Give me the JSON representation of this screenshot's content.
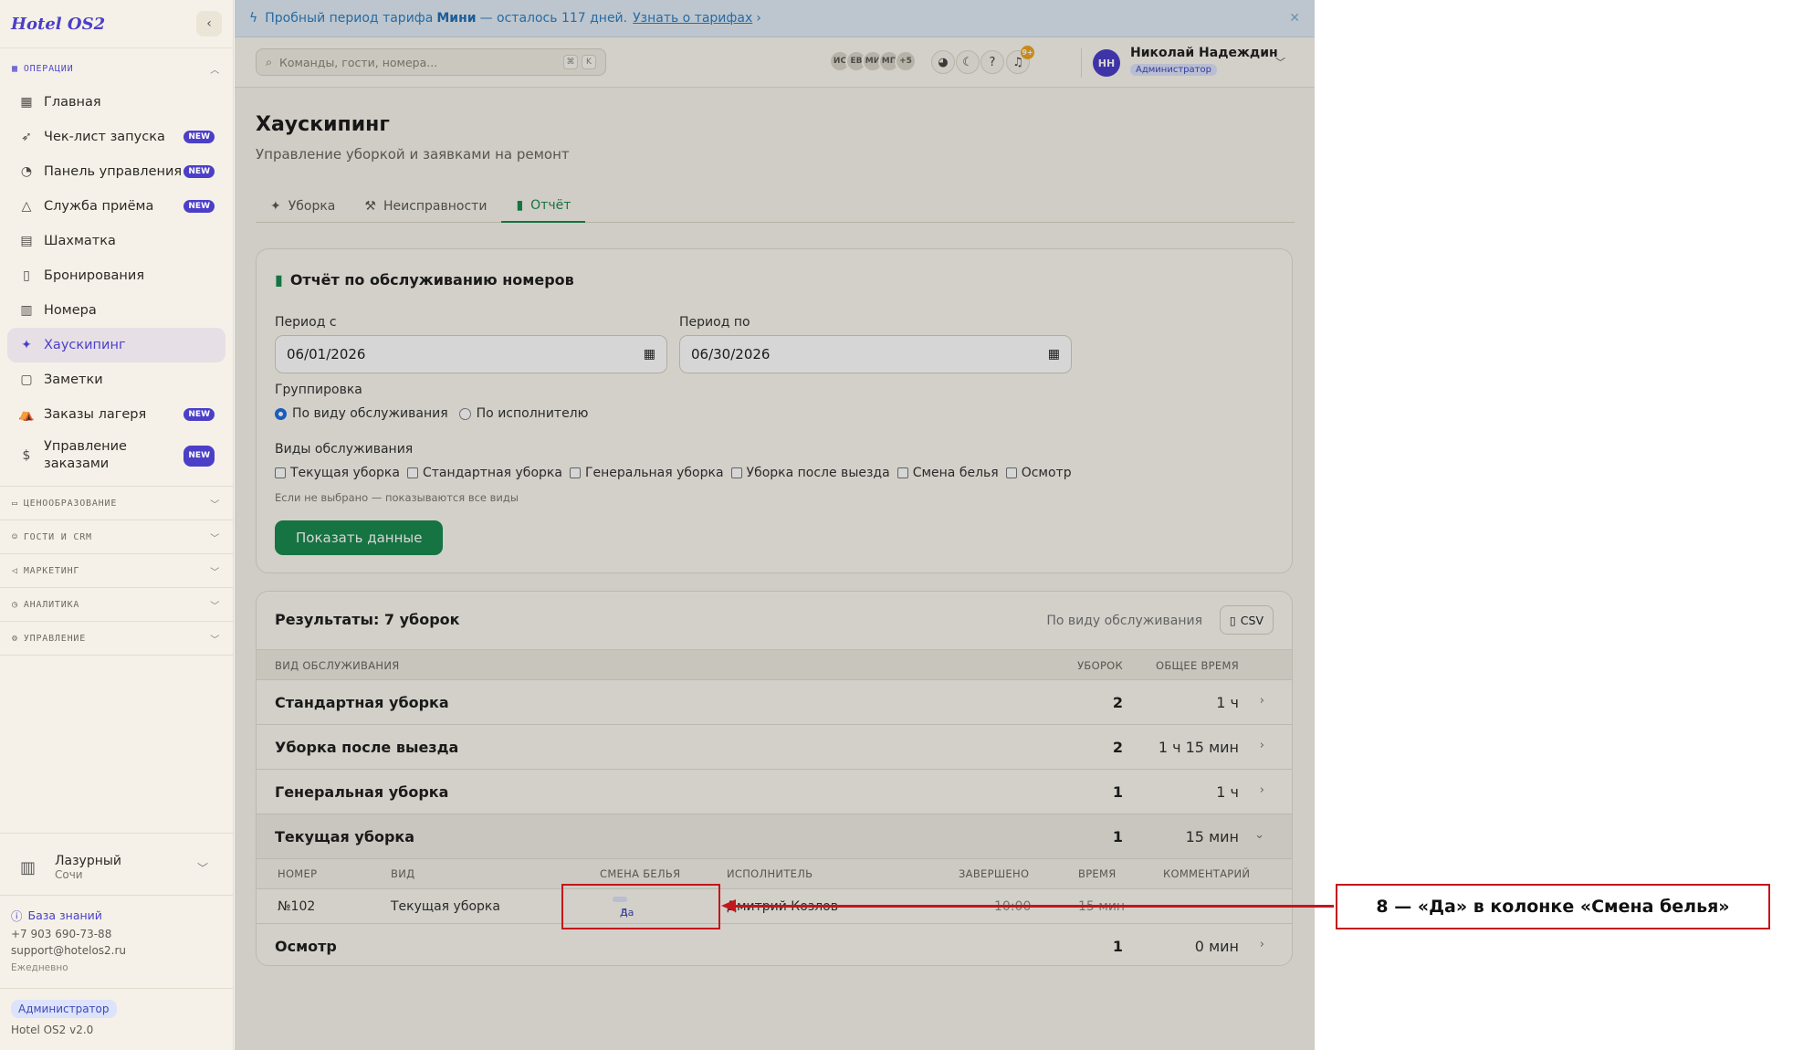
{
  "sidebar": {
    "brand": "Hotel OS2",
    "operations_label": "ОПЕРАЦИИ",
    "items": [
      {
        "label": "Главная",
        "badge": ""
      },
      {
        "label": "Чек-лист запуска",
        "badge": "NEW"
      },
      {
        "label": "Панель управления",
        "badge": "NEW"
      },
      {
        "label": "Служба приёма",
        "badge": "NEW"
      },
      {
        "label": "Шахматка",
        "badge": ""
      },
      {
        "label": "Бронирования",
        "badge": ""
      },
      {
        "label": "Номера",
        "badge": ""
      },
      {
        "label": "Хаускипинг",
        "badge": "",
        "active": true
      },
      {
        "label": "Заметки",
        "badge": ""
      },
      {
        "label": "Заказы лагеря",
        "badge": "NEW"
      },
      {
        "label": "Управление заказами",
        "badge": "NEW"
      }
    ],
    "sections": [
      "ЦЕНООБРАЗОВАНИЕ",
      "ГОСТИ И CRM",
      "МАРКЕТИНГ",
      "АНАЛИТИКА",
      "УПРАВЛЕНИЕ"
    ],
    "hotel": {
      "name": "Лазурный",
      "city": "Сочи"
    },
    "knowledge_base": "База знаний",
    "phone": "+7 903 690-73-88",
    "email": "support@hotelos2.ru",
    "schedule": "Ежедневно",
    "role": "Администратор",
    "version": "Hotel OS2 v2.0"
  },
  "banner": {
    "prefix": "Пробный период тарифа",
    "plan": "Мини",
    "suffix": "— осталось 117 дней.",
    "link": "Узнать о тарифах"
  },
  "topbar": {
    "search_placeholder": "Команды, гости, номера...",
    "kbd": [
      "⌘",
      "K"
    ],
    "avatars": [
      "ИС",
      "ЕВ",
      "МИ",
      "МП",
      "+5"
    ],
    "notif_count": "9+",
    "user_initials": "НН",
    "user_name": "Николай Надеждин",
    "user_role": "Администратор"
  },
  "page": {
    "title": "Хаускипинг",
    "subtitle": "Управление уборкой и заявками на ремонт",
    "tabs": [
      "Уборка",
      "Неисправности",
      "Отчёт"
    ],
    "active_tab": "Отчёт"
  },
  "filters": {
    "title": "Отчёт по обслуживанию номеров",
    "from_label": "Период с",
    "from_value": "06/01/2026",
    "to_label": "Период по",
    "to_value": "06/30/2026",
    "grouping_label": "Группировка",
    "grouping_options": [
      "По виду обслуживания",
      "По исполнителю"
    ],
    "grouping_selected": "По виду обслуживания",
    "types_label": "Виды обслуживания",
    "types": [
      "Текущая уборка",
      "Стандартная уборка",
      "Генеральная уборка",
      "Уборка после выезда",
      "Смена белья",
      "Осмотр"
    ],
    "hint": "Если не выбрано — показываются все виды",
    "show_button": "Показать данные"
  },
  "results": {
    "title": "Результаты: 7 уборок",
    "group_by": "По виду обслуживания",
    "csv": "CSV",
    "columns": [
      "ВИД ОБСЛУЖИВАНИЯ",
      "УБОРОК",
      "ОБЩЕЕ ВРЕМЯ"
    ],
    "groups": [
      {
        "name": "Стандартная уборка",
        "count": "2",
        "time": "1 ч",
        "arrow": "›"
      },
      {
        "name": "Уборка после выезда",
        "count": "2",
        "time": "1 ч 15 мин",
        "arrow": "›"
      },
      {
        "name": "Генеральная уборка",
        "count": "1",
        "time": "1 ч",
        "arrow": "›"
      },
      {
        "name": "Текущая уборка",
        "count": "1",
        "time": "15 мин",
        "arrow": "⌄"
      },
      {
        "name": "Осмотр",
        "count": "1",
        "time": "0 мин",
        "arrow": "›"
      }
    ],
    "detail_columns": [
      "НОМЕР",
      "ВИД",
      "СМЕНА БЕЛЬЯ",
      "ИСПОЛНИТЕЛЬ",
      "ЗАВЕРШЕНО",
      "ВРЕМЯ",
      "КОММЕНТАРИЙ"
    ],
    "detail_row": {
      "room": "№102",
      "type": "Текущая уборка",
      "linen": "Да",
      "staff": "Дмитрий Козлов",
      "completed": "10:00",
      "time": "15 мин",
      "comment": "—"
    }
  },
  "annotation": {
    "label": "8 — «Да» в колонке «Смена белья»",
    "color": "#c4161c"
  }
}
